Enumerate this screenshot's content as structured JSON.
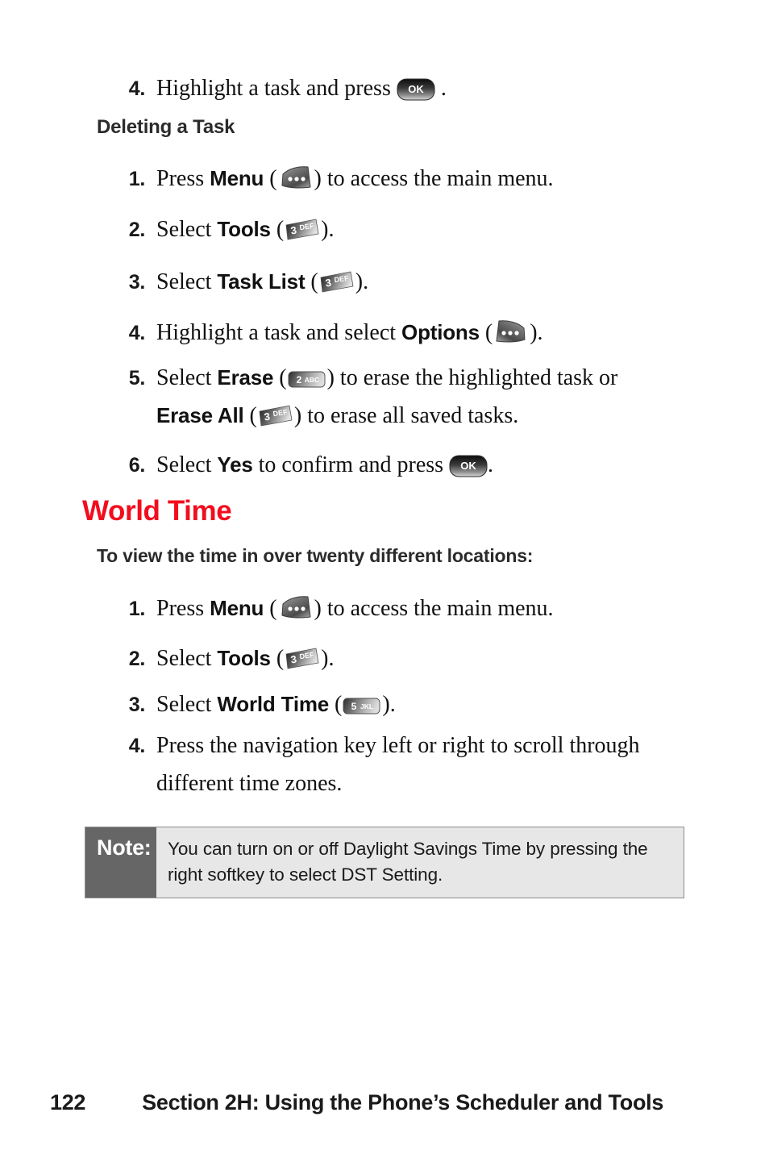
{
  "page": {
    "number": "122",
    "footer_title": "Section 2H: Using the Phone’s Scheduler and Tools"
  },
  "colors": {
    "heading_red": "#F20D1E",
    "note_label_bg": "#666666",
    "note_body_bg": "#E7E7E7",
    "text": "#111111"
  },
  "task_tail": {
    "step4_num": "4.",
    "step4_text_before": "Highlight a task and press",
    "step4_text_after": ".",
    "step4_key": "ok-key"
  },
  "deleting_section": {
    "heading": "Deleting a Task",
    "steps": [
      {
        "num": "1.",
        "pre": "Press",
        "bold": "Menu",
        "open": "(",
        "key": "left-softkey",
        "close": ")",
        "post": "to access the main menu."
      },
      {
        "num": "2.",
        "pre": "Select",
        "bold": "Tools",
        "open": "(",
        "key": "key-3-def",
        "close": ")",
        "post": "."
      },
      {
        "num": "3.",
        "pre": "Select",
        "bold": "Task List",
        "open": "(",
        "key": "key-3-def",
        "close": ")",
        "post": "."
      },
      {
        "num": "4.",
        "pre": "Highlight a task and select",
        "bold": "Options",
        "open": "(",
        "key": "right-softkey",
        "close": ")",
        "post": "."
      },
      {
        "num": "5.",
        "pre": "Select",
        "bold": "Erase",
        "open": "(",
        "key": "key-2-abc",
        "close": ")",
        "post": "to erase the highlighted task or",
        "bold2": "Erase All",
        "open2": "(",
        "key2": "key-3-def",
        "close2": ")",
        "post2": "to erase all saved tasks."
      },
      {
        "num": "6.",
        "pre": "Select",
        "bold": "Yes",
        "post": "to confirm and press",
        "key": "ok-key",
        "tail": "."
      }
    ]
  },
  "world_time_section": {
    "heading": "World Time",
    "lead_in": "To view the time in over twenty different locations:",
    "steps": [
      {
        "num": "1.",
        "pre": "Press",
        "bold": "Menu",
        "open": "(",
        "key": "left-softkey",
        "close": ")",
        "post": "to access the main menu."
      },
      {
        "num": "2.",
        "pre": "Select",
        "bold": "Tools",
        "open": "(",
        "key": "key-3-def",
        "close": ")",
        "post": "."
      },
      {
        "num": "3.",
        "pre": "Select",
        "bold": "World Time",
        "open": "(",
        "key": "key-5-jkl",
        "close": ")",
        "post": "."
      },
      {
        "num": "4.",
        "text": "Press the navigation key left or right to scroll through different time zones."
      }
    ]
  },
  "note": {
    "label": "Note:",
    "text": "You can turn on or off Daylight Savings Time by pressing the right softkey to select DST Setting."
  },
  "key_glyphs": {
    "ok": "OK",
    "key3_digit": "3",
    "key3_letters": "DEF",
    "key2_digit": "2",
    "key2_letters": "ABC",
    "key5_digit": "5",
    "key5_letters": "JKL"
  }
}
